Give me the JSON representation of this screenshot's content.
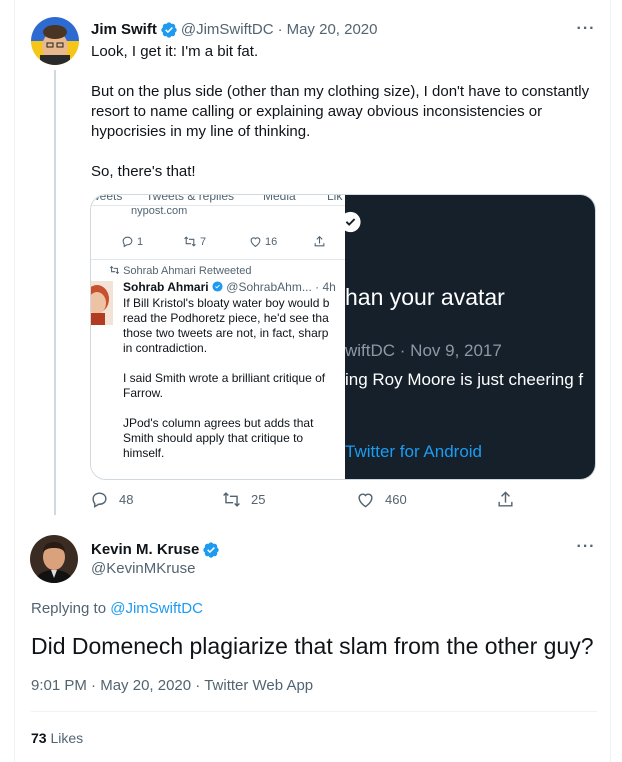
{
  "parent_tweet": {
    "author_name": "Jim Swift",
    "author_handle": "@JimSwiftDC",
    "separator": "·",
    "date": "May 20, 2020",
    "paragraphs": [
      [
        "Look, I get it: I'm a bit fat."
      ],
      [
        "But on the plus side (other than my clothing size), I don't have to constantly",
        "resort to name calling or explaining away obvious inconsistencies or",
        "hypocrisies in my line of thinking."
      ],
      [
        "So, there's that!"
      ]
    ],
    "stats": {
      "replies": "48",
      "retweets": "25",
      "likes": "460"
    }
  },
  "media": {
    "left": {
      "tabs": [
        "weets",
        "Tweets & replies",
        "Media",
        "Lik"
      ],
      "url_fragment": "nypost.com",
      "actions": {
        "replies": "1",
        "retweets": "7",
        "likes": "16"
      },
      "retweet_notice": "Sohrab Ahmari Retweeted",
      "author_name": "Sohrab Ahmari",
      "author_handle": "@SohrabAhm...",
      "time": "· 4h",
      "body_lines": [
        "If Bill Kristol's bloaty water boy would b",
        "read the Podhoretz piece, he'd see tha",
        "those two tweets are not, in fact, sharp",
        "in contradiction.",
        "",
        "I said Smith wrote a brilliant critique of",
        "Farrow.",
        "",
        "JPod's column agrees but adds that",
        "Smith should apply that critique to",
        "himself."
      ]
    },
    "right": {
      "line1": "han your avatar",
      "line2": "wiftDC · Nov 9, 2017",
      "line3": "ing Roy Moore is just cheering f",
      "line4": "Twitter for Android"
    }
  },
  "main_tweet": {
    "author_name": "Kevin M. Kruse",
    "author_handle": "@KevinMKruse",
    "replying_prefix": "Replying to",
    "replying_handle": "@JimSwiftDC",
    "text": "Did Domenech plagiarize that slam from the other guy?",
    "time": "9:01 PM",
    "date": "May 20, 2020",
    "source": "Twitter Web App",
    "likes_count": "73",
    "likes_label": "Likes"
  },
  "more_icon": "···",
  "colors": {
    "accent": "#1d9bf0",
    "muted": "#536471",
    "dark_bg": "#15202b"
  }
}
